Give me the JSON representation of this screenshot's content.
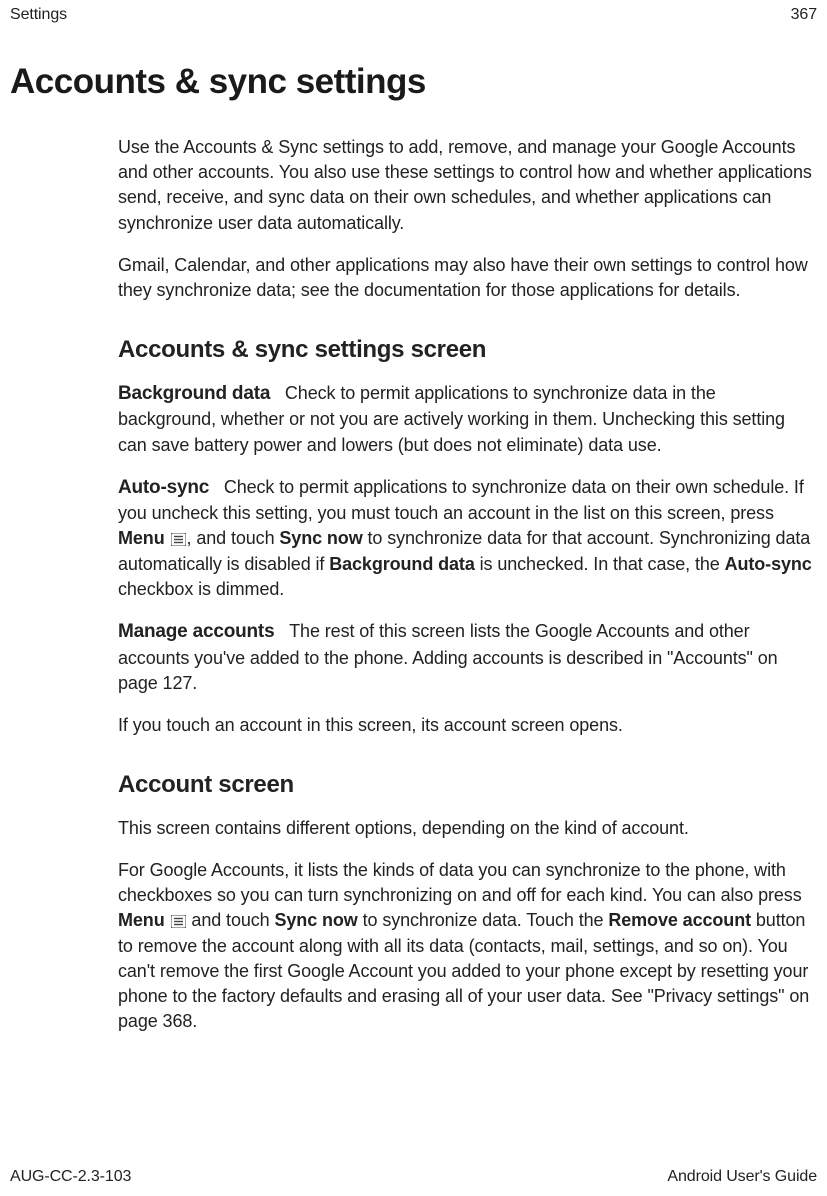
{
  "header": {
    "section": "Settings",
    "page_number": "367"
  },
  "title": "Accounts & sync settings",
  "intro": {
    "p1": "Use the Accounts & Sync settings to add, remove, and manage your Google Accounts and other accounts. You also use these settings to control how and whether applications send, receive, and sync data on their own schedules, and whether applications can synchronize user data automatically.",
    "p2": "Gmail, Calendar, and other applications may also have their own settings to control how they synchronize data; see the documentation for those applications for details."
  },
  "section1": {
    "heading": "Accounts & sync settings screen",
    "background_data": {
      "term": "Background data",
      "text": "Check to permit applications to synchronize data in the background, whether or not you are actively working in them. Unchecking this setting can save battery power and lowers (but does not eliminate) data use."
    },
    "auto_sync": {
      "term": "Auto-sync",
      "pre": "Check to permit applications to synchronize data on their own schedule. If you uncheck this setting, you must touch an account in the list on this screen, press ",
      "menu_word": "Menu",
      "mid1": ", and touch ",
      "sync_now": "Sync now",
      "mid2": " to synchronize data for that account. Synchronizing data automatically is disabled if ",
      "bg_data": "Background data",
      "mid3": " is unchecked. In that case, the ",
      "auto_sync_word": "Auto-sync",
      "end": " checkbox is dimmed."
    },
    "manage_accounts": {
      "term": "Manage accounts",
      "text": "The rest of this screen lists the Google Accounts and other accounts you've added to the phone. Adding accounts is described in \"Accounts\" on page 127."
    },
    "p_after": "If you touch an account in this screen, its account screen opens."
  },
  "section2": {
    "heading": "Account screen",
    "p1": "This screen contains different options, depending on the kind of account.",
    "p2": {
      "pre": "For Google Accounts, it lists the kinds of data you can synchronize to the phone, with checkboxes so you can turn synchronizing on and off for each kind. You can also press ",
      "menu_word": "Menu",
      "mid1": " and touch ",
      "sync_now": "Sync now",
      "mid2": " to synchronize data. Touch the ",
      "remove_account": "Remove account",
      "end": " button to remove the account along with all its data (contacts, mail, settings, and so on). You can't remove the first Google Account you added to your phone except by resetting your phone to the factory defaults and erasing all of your user data. See \"Privacy settings\" on page 368."
    }
  },
  "footer": {
    "doc_id": "AUG-CC-2.3-103",
    "guide": "Android User's Guide"
  }
}
